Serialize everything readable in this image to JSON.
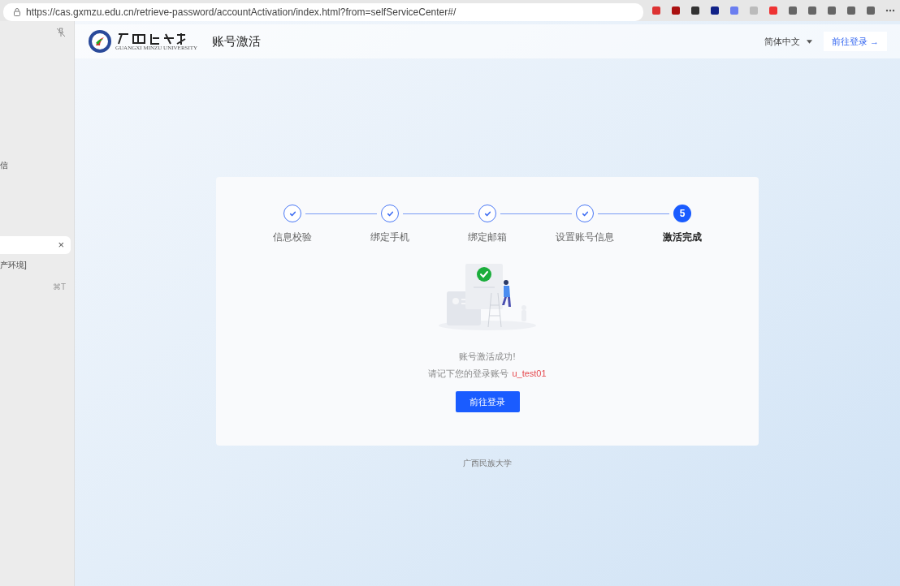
{
  "browser": {
    "url": "https://cas.gxmzu.edu.cn/retrieve-password/accountActivation/index.html?from=selfServiceCenter#/"
  },
  "sidebar": {
    "items": [
      {
        "label": "信"
      }
    ],
    "search": {
      "clear": "×"
    },
    "results": [
      {
        "label": "产环境]"
      }
    ],
    "shortcut": "⌘T"
  },
  "header": {
    "logo_subtitle": "GUANGXI MINZU UNIVERSITY",
    "title": "账号激活",
    "language": "简体中文",
    "login_link": "前往登录 →"
  },
  "steps": [
    {
      "label": "信息校验",
      "completed": true,
      "selected": false
    },
    {
      "label": "绑定手机",
      "completed": true,
      "selected": false
    },
    {
      "label": "绑定邮箱",
      "completed": true,
      "selected": false
    },
    {
      "label": "设置账号信息",
      "completed": true,
      "selected": false
    },
    {
      "label": "激活完成",
      "completed": false,
      "selected": true,
      "number": "5"
    }
  ],
  "result": {
    "message": "账号激活成功!",
    "account_prompt": "请记下您的登录账号",
    "account": "u_test01",
    "button": "前往登录"
  },
  "footer": "广西民族大学"
}
